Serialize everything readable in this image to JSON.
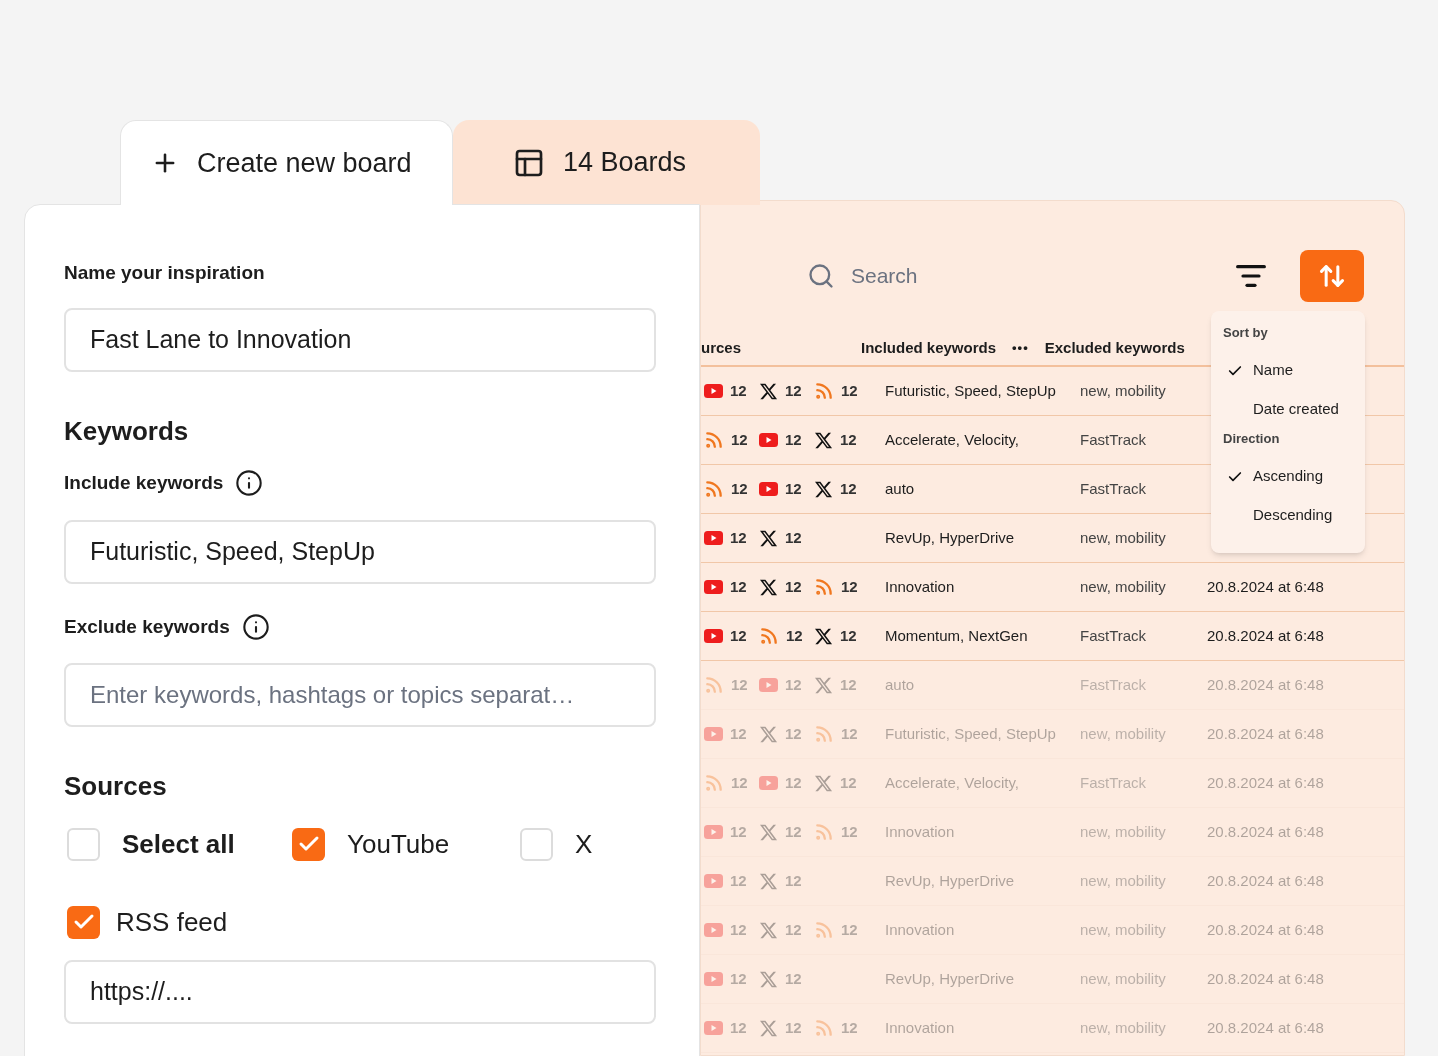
{
  "tabs": [
    {
      "label": "Create new board",
      "kind": "plus",
      "selected": true
    },
    {
      "label": "14 Boards",
      "kind": "board",
      "selected": false
    }
  ],
  "form": {
    "name_label": "Name your inspiration",
    "name_value": "Fast Lane to Innovation",
    "keywords_heading": "Keywords",
    "include_label": "Include keywords",
    "include_value": "Futuristic, Speed, StepUp",
    "exclude_label": "Exclude keywords",
    "exclude_placeholder": "Enter keywords, hashtags or topics separat…",
    "sources_heading": "Sources",
    "sources": [
      {
        "label": "Select all",
        "checked": false,
        "bold": true
      },
      {
        "label": "YouTube",
        "checked": true,
        "bold": false
      },
      {
        "label": "X",
        "checked": false,
        "bold": false
      },
      {
        "label": "RSS feed",
        "checked": true,
        "bold": false
      }
    ],
    "url_value": "https://...."
  },
  "boards": {
    "search_placeholder": "Search",
    "columns": [
      "urces",
      "Included keywords",
      "Excluded keywords"
    ],
    "more": "•••",
    "rows": [
      {
        "faded": false,
        "sources": [
          {
            "kind": "youtube",
            "count": "12"
          },
          {
            "kind": "x",
            "count": "12"
          },
          {
            "kind": "rss",
            "count": "12"
          }
        ],
        "included": "Futuristic, Speed, StepUp",
        "excluded": "new, mobility"
      },
      {
        "faded": false,
        "sources": [
          {
            "kind": "rss",
            "count": "12"
          },
          {
            "kind": "youtube",
            "count": "12"
          },
          {
            "kind": "x",
            "count": "12"
          }
        ],
        "included": "Accelerate, Velocity,",
        "excluded": "FastTrack"
      },
      {
        "faded": false,
        "sources": [
          {
            "kind": "rss",
            "count": "12"
          },
          {
            "kind": "youtube",
            "count": "12"
          },
          {
            "kind": "x",
            "count": "12"
          }
        ],
        "included": "auto",
        "excluded": "FastTrack"
      },
      {
        "faded": false,
        "sources": [
          {
            "kind": "youtube",
            "count": "12"
          },
          {
            "kind": "x",
            "count": "12"
          }
        ],
        "included": "RevUp, HyperDrive",
        "excluded": "new, mobility"
      },
      {
        "faded": false,
        "sources": [
          {
            "kind": "youtube",
            "count": "12"
          },
          {
            "kind": "x",
            "count": "12"
          },
          {
            "kind": "rss",
            "count": "12"
          }
        ],
        "included": "Innovation",
        "excluded": "new, mobility",
        "date": "20.8.2024 at 6:48"
      },
      {
        "faded": false,
        "sources": [
          {
            "kind": "youtube",
            "count": "12"
          },
          {
            "kind": "rss",
            "count": "12"
          },
          {
            "kind": "x",
            "count": "12"
          }
        ],
        "included": "Momentum, NextGen",
        "excluded": "FastTrack",
        "date": "20.8.2024 at 6:48"
      },
      {
        "faded": true,
        "sources": [
          {
            "kind": "rss",
            "count": "12"
          },
          {
            "kind": "youtube",
            "count": "12"
          },
          {
            "kind": "x",
            "count": "12"
          }
        ],
        "included": "auto",
        "excluded": "FastTrack",
        "date": "20.8.2024 at 6:48"
      },
      {
        "faded": true,
        "sources": [
          {
            "kind": "youtube",
            "count": "12"
          },
          {
            "kind": "x",
            "count": "12"
          },
          {
            "kind": "rss",
            "count": "12"
          }
        ],
        "included": "Futuristic, Speed, StepUp",
        "excluded": "new, mobility",
        "date": "20.8.2024 at 6:48"
      },
      {
        "faded": true,
        "sources": [
          {
            "kind": "rss",
            "count": "12"
          },
          {
            "kind": "youtube",
            "count": "12"
          },
          {
            "kind": "x",
            "count": "12"
          }
        ],
        "included": "Accelerate, Velocity,",
        "excluded": "FastTrack",
        "date": "20.8.2024 at 6:48"
      },
      {
        "faded": true,
        "sources": [
          {
            "kind": "youtube",
            "count": "12"
          },
          {
            "kind": "x",
            "count": "12"
          },
          {
            "kind": "rss",
            "count": "12"
          }
        ],
        "included": "Innovation",
        "excluded": "new, mobility",
        "date": "20.8.2024 at 6:48"
      },
      {
        "faded": true,
        "sources": [
          {
            "kind": "youtube",
            "count": "12"
          },
          {
            "kind": "x",
            "count": "12"
          }
        ],
        "included": "RevUp, HyperDrive",
        "excluded": "new, mobility",
        "date": "20.8.2024 at 6:48"
      },
      {
        "faded": true,
        "sources": [
          {
            "kind": "youtube",
            "count": "12"
          },
          {
            "kind": "x",
            "count": "12"
          },
          {
            "kind": "rss",
            "count": "12"
          }
        ],
        "included": "Innovation",
        "excluded": "new, mobility",
        "date": "20.8.2024 at 6:48"
      },
      {
        "faded": true,
        "sources": [
          {
            "kind": "youtube",
            "count": "12"
          },
          {
            "kind": "x",
            "count": "12"
          }
        ],
        "included": "RevUp, HyperDrive",
        "excluded": "new, mobility",
        "date": "20.8.2024 at 6:48"
      },
      {
        "faded": true,
        "sources": [
          {
            "kind": "youtube",
            "count": "12"
          },
          {
            "kind": "x",
            "count": "12"
          },
          {
            "kind": "rss",
            "count": "12"
          }
        ],
        "included": "Innovation",
        "excluded": "new, mobility",
        "date": "20.8.2024 at 6:48"
      }
    ],
    "sort_menu": [
      {
        "heading": "Sort by",
        "options": [
          {
            "label": "Name",
            "selected": true
          },
          {
            "label": "Date created",
            "selected": false
          }
        ]
      },
      {
        "heading": "Direction",
        "options": [
          {
            "label": "Ascending",
            "selected": true
          },
          {
            "label": "Descending",
            "selected": false
          }
        ]
      }
    ]
  }
}
